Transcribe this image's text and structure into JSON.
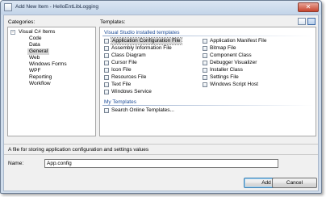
{
  "window": {
    "title": "Add New Item - HelloEntLibLogging",
    "close_glyph": "✕"
  },
  "categories": {
    "label": "Categories:",
    "root": "Visual C# Items",
    "root_toggle": "−",
    "items": [
      "Code",
      "Data",
      "General",
      "Web",
      "Windows Forms",
      "WPF",
      "Reporting",
      "Workflow"
    ],
    "selected": "General"
  },
  "templates": {
    "label": "Templates:",
    "installed_header": "Visual Studio installed templates",
    "installed_left": [
      {
        "label": "Application Configuration File",
        "icon": "config-file-icon"
      },
      {
        "label": "Assembly Information File",
        "icon": "assembly-info-icon"
      },
      {
        "label": "Class Diagram",
        "icon": "class-diagram-icon"
      },
      {
        "label": "Cursor File",
        "icon": "cursor-file-icon"
      },
      {
        "label": "Icon File",
        "icon": "icon-file-icon"
      },
      {
        "label": "Resources File",
        "icon": "resources-file-icon"
      },
      {
        "label": "Text File",
        "icon": "text-file-icon"
      },
      {
        "label": "Windows Service",
        "icon": "windows-service-icon"
      }
    ],
    "installed_right": [
      {
        "label": "Application Manifest File",
        "icon": "manifest-file-icon"
      },
      {
        "label": "Bitmap File",
        "icon": "bitmap-file-icon"
      },
      {
        "label": "Component Class",
        "icon": "component-class-icon"
      },
      {
        "label": "Debugger Visualizer",
        "icon": "debugger-visualizer-icon"
      },
      {
        "label": "Installer Class",
        "icon": "installer-class-icon"
      },
      {
        "label": "Settings File",
        "icon": "settings-file-icon"
      },
      {
        "label": "Windows Script Host",
        "icon": "script-host-icon"
      }
    ],
    "my_header": "My Templates",
    "my_items": [
      {
        "label": "Search Online Templates...",
        "icon": "search-online-icon"
      }
    ],
    "selected": "Application Configuration File"
  },
  "description": "A file for storing application configuration and settings values",
  "name_field": {
    "label": "Name:",
    "value": "App.config"
  },
  "buttons": {
    "add": "Add",
    "cancel": "Cancel"
  },
  "colors": {
    "group_header": "#1f4e99",
    "selection": "#d6d6d6",
    "frame": "#cfdceb"
  }
}
